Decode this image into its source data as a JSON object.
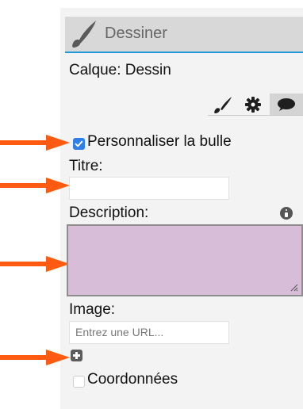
{
  "header": {
    "title": "Dessiner",
    "icon": "paintbrush-icon"
  },
  "layer": {
    "label": "Calque: Dessin"
  },
  "tabs": [
    {
      "icon": "brush-icon",
      "selected": false
    },
    {
      "icon": "gear-icon",
      "selected": false
    },
    {
      "icon": "speech-bubble-icon",
      "selected": true
    }
  ],
  "bubble": {
    "customize_label": "Personnaliser la bulle",
    "customize_checked": true,
    "title_label": "Titre:",
    "title_value": "",
    "description_label": "Description:",
    "description_value": "",
    "image_label": "Image:",
    "image_placeholder": "Entrez une URL...",
    "coordinates_label": "Coordonnées",
    "coordinates_checked": false
  },
  "colors": {
    "accent": "#1f9ad6",
    "arrow": "#ff5a12",
    "description_fill": "#d8bdd8"
  }
}
